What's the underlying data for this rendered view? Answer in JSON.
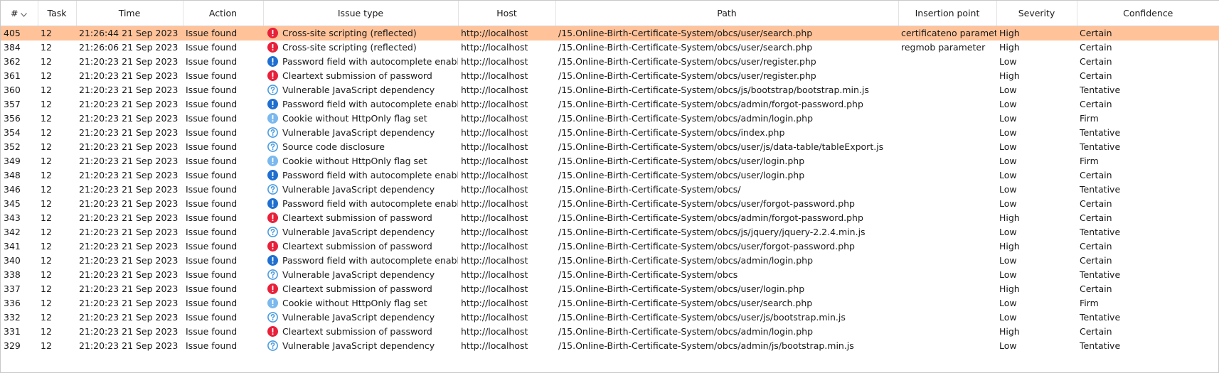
{
  "colors": {
    "selected_row": "#ffc299",
    "high": "#e8203a",
    "medium_info": "#1f6fd1",
    "low_info": "#7ab8ee",
    "tentative": "#4a9be0"
  },
  "columns": [
    "#",
    "Task",
    "Time",
    "Action",
    "Issue type",
    "Host",
    "Path",
    "Insertion point",
    "Severity",
    "Confidence"
  ],
  "rows": [
    {
      "id": "405",
      "task": "12",
      "time": "21:26:44 21 Sep 2023",
      "action": "Issue found",
      "icon": "high-severity-icon",
      "issue": "Cross-site scripting (reflected)",
      "host": "http://localhost",
      "path": "/15.Online-Birth-Certificate-System/obcs/user/search.php",
      "insertion": "certificateno parameter",
      "severity": "High",
      "confidence": "Certain",
      "selected": true
    },
    {
      "id": "384",
      "task": "12",
      "time": "21:26:06 21 Sep 2023",
      "action": "Issue found",
      "icon": "high-severity-icon",
      "issue": "Cross-site scripting (reflected)",
      "host": "http://localhost",
      "path": "/15.Online-Birth-Certificate-System/obcs/user/search.php",
      "insertion": "regmob parameter",
      "severity": "High",
      "confidence": "Certain"
    },
    {
      "id": "362",
      "task": "12",
      "time": "21:20:23 21 Sep 2023",
      "action": "Issue found",
      "icon": "low-certain-icon",
      "issue": "Password field with autocomplete enabled",
      "host": "http://localhost",
      "path": "/15.Online-Birth-Certificate-System/obcs/user/register.php",
      "insertion": "",
      "severity": "Low",
      "confidence": "Certain"
    },
    {
      "id": "361",
      "task": "12",
      "time": "21:20:23 21 Sep 2023",
      "action": "Issue found",
      "icon": "high-severity-icon",
      "issue": "Cleartext submission of password",
      "host": "http://localhost",
      "path": "/15.Online-Birth-Certificate-System/obcs/user/register.php",
      "insertion": "",
      "severity": "High",
      "confidence": "Certain"
    },
    {
      "id": "360",
      "task": "12",
      "time": "21:20:23 21 Sep 2023",
      "action": "Issue found",
      "icon": "tentative-icon",
      "issue": "Vulnerable JavaScript dependency",
      "host": "http://localhost",
      "path": "/15.Online-Birth-Certificate-System/obcs/js/bootstrap/bootstrap.min.js",
      "insertion": "",
      "severity": "Low",
      "confidence": "Tentative"
    },
    {
      "id": "357",
      "task": "12",
      "time": "21:20:23 21 Sep 2023",
      "action": "Issue found",
      "icon": "low-certain-icon",
      "issue": "Password field with autocomplete enabled",
      "host": "http://localhost",
      "path": "/15.Online-Birth-Certificate-System/obcs/admin/forgot-password.php",
      "insertion": "",
      "severity": "Low",
      "confidence": "Certain"
    },
    {
      "id": "356",
      "task": "12",
      "time": "21:20:23 21 Sep 2023",
      "action": "Issue found",
      "icon": "low-firm-icon",
      "issue": "Cookie without HttpOnly flag set",
      "host": "http://localhost",
      "path": "/15.Online-Birth-Certificate-System/obcs/admin/login.php",
      "insertion": "",
      "severity": "Low",
      "confidence": "Firm"
    },
    {
      "id": "354",
      "task": "12",
      "time": "21:20:23 21 Sep 2023",
      "action": "Issue found",
      "icon": "tentative-icon",
      "issue": "Vulnerable JavaScript dependency",
      "host": "http://localhost",
      "path": "/15.Online-Birth-Certificate-System/obcs/index.php",
      "insertion": "",
      "severity": "Low",
      "confidence": "Tentative"
    },
    {
      "id": "352",
      "task": "12",
      "time": "21:20:23 21 Sep 2023",
      "action": "Issue found",
      "icon": "tentative-icon",
      "issue": "Source code disclosure",
      "host": "http://localhost",
      "path": "/15.Online-Birth-Certificate-System/obcs/user/js/data-table/tableExport.js",
      "insertion": "",
      "severity": "Low",
      "confidence": "Tentative"
    },
    {
      "id": "349",
      "task": "12",
      "time": "21:20:23 21 Sep 2023",
      "action": "Issue found",
      "icon": "low-firm-icon",
      "issue": "Cookie without HttpOnly flag set",
      "host": "http://localhost",
      "path": "/15.Online-Birth-Certificate-System/obcs/user/login.php",
      "insertion": "",
      "severity": "Low",
      "confidence": "Firm"
    },
    {
      "id": "348",
      "task": "12",
      "time": "21:20:23 21 Sep 2023",
      "action": "Issue found",
      "icon": "low-certain-icon",
      "issue": "Password field with autocomplete enabled",
      "host": "http://localhost",
      "path": "/15.Online-Birth-Certificate-System/obcs/user/login.php",
      "insertion": "",
      "severity": "Low",
      "confidence": "Certain"
    },
    {
      "id": "346",
      "task": "12",
      "time": "21:20:23 21 Sep 2023",
      "action": "Issue found",
      "icon": "tentative-icon",
      "issue": "Vulnerable JavaScript dependency",
      "host": "http://localhost",
      "path": "/15.Online-Birth-Certificate-System/obcs/",
      "insertion": "",
      "severity": "Low",
      "confidence": "Tentative"
    },
    {
      "id": "345",
      "task": "12",
      "time": "21:20:23 21 Sep 2023",
      "action": "Issue found",
      "icon": "low-certain-icon",
      "issue": "Password field with autocomplete enabled",
      "host": "http://localhost",
      "path": "/15.Online-Birth-Certificate-System/obcs/user/forgot-password.php",
      "insertion": "",
      "severity": "Low",
      "confidence": "Certain"
    },
    {
      "id": "343",
      "task": "12",
      "time": "21:20:23 21 Sep 2023",
      "action": "Issue found",
      "icon": "high-severity-icon",
      "issue": "Cleartext submission of password",
      "host": "http://localhost",
      "path": "/15.Online-Birth-Certificate-System/obcs/admin/forgot-password.php",
      "insertion": "",
      "severity": "High",
      "confidence": "Certain"
    },
    {
      "id": "342",
      "task": "12",
      "time": "21:20:23 21 Sep 2023",
      "action": "Issue found",
      "icon": "tentative-icon",
      "issue": "Vulnerable JavaScript dependency",
      "host": "http://localhost",
      "path": "/15.Online-Birth-Certificate-System/obcs/js/jquery/jquery-2.2.4.min.js",
      "insertion": "",
      "severity": "Low",
      "confidence": "Tentative"
    },
    {
      "id": "341",
      "task": "12",
      "time": "21:20:23 21 Sep 2023",
      "action": "Issue found",
      "icon": "high-severity-icon",
      "issue": "Cleartext submission of password",
      "host": "http://localhost",
      "path": "/15.Online-Birth-Certificate-System/obcs/user/forgot-password.php",
      "insertion": "",
      "severity": "High",
      "confidence": "Certain"
    },
    {
      "id": "340",
      "task": "12",
      "time": "21:20:23 21 Sep 2023",
      "action": "Issue found",
      "icon": "low-certain-icon",
      "issue": "Password field with autocomplete enabled",
      "host": "http://localhost",
      "path": "/15.Online-Birth-Certificate-System/obcs/admin/login.php",
      "insertion": "",
      "severity": "Low",
      "confidence": "Certain"
    },
    {
      "id": "338",
      "task": "12",
      "time": "21:20:23 21 Sep 2023",
      "action": "Issue found",
      "icon": "tentative-icon",
      "issue": "Vulnerable JavaScript dependency",
      "host": "http://localhost",
      "path": "/15.Online-Birth-Certificate-System/obcs",
      "insertion": "",
      "severity": "Low",
      "confidence": "Tentative"
    },
    {
      "id": "337",
      "task": "12",
      "time": "21:20:23 21 Sep 2023",
      "action": "Issue found",
      "icon": "high-severity-icon",
      "issue": "Cleartext submission of password",
      "host": "http://localhost",
      "path": "/15.Online-Birth-Certificate-System/obcs/user/login.php",
      "insertion": "",
      "severity": "High",
      "confidence": "Certain"
    },
    {
      "id": "336",
      "task": "12",
      "time": "21:20:23 21 Sep 2023",
      "action": "Issue found",
      "icon": "low-firm-icon",
      "issue": "Cookie without HttpOnly flag set",
      "host": "http://localhost",
      "path": "/15.Online-Birth-Certificate-System/obcs/user/search.php",
      "insertion": "",
      "severity": "Low",
      "confidence": "Firm"
    },
    {
      "id": "332",
      "task": "12",
      "time": "21:20:23 21 Sep 2023",
      "action": "Issue found",
      "icon": "tentative-icon",
      "issue": "Vulnerable JavaScript dependency",
      "host": "http://localhost",
      "path": "/15.Online-Birth-Certificate-System/obcs/user/js/bootstrap.min.js",
      "insertion": "",
      "severity": "Low",
      "confidence": "Tentative"
    },
    {
      "id": "331",
      "task": "12",
      "time": "21:20:23 21 Sep 2023",
      "action": "Issue found",
      "icon": "high-severity-icon",
      "issue": "Cleartext submission of password",
      "host": "http://localhost",
      "path": "/15.Online-Birth-Certificate-System/obcs/admin/login.php",
      "insertion": "",
      "severity": "High",
      "confidence": "Certain"
    },
    {
      "id": "329",
      "task": "12",
      "time": "21:20:23 21 Sep 2023",
      "action": "Issue found",
      "icon": "tentative-icon",
      "issue": "Vulnerable JavaScript dependency",
      "host": "http://localhost",
      "path": "/15.Online-Birth-Certificate-System/obcs/admin/js/bootstrap.min.js",
      "insertion": "",
      "severity": "Low",
      "confidence": "Tentative"
    }
  ]
}
